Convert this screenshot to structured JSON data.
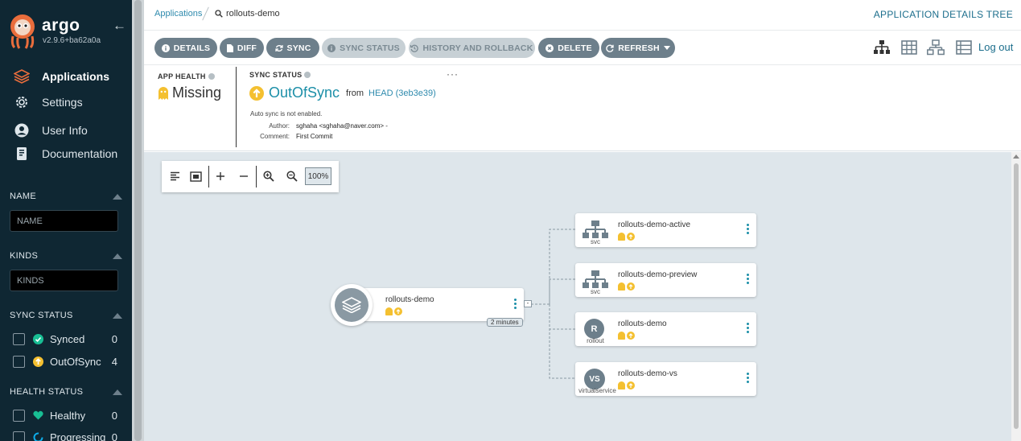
{
  "app": {
    "brand": "argo",
    "version": "v2.9.6+ba62a0a"
  },
  "nav": [
    {
      "label": "Applications",
      "icon": "layers-icon",
      "active": true
    },
    {
      "label": "Settings",
      "icon": "gear-icon"
    },
    {
      "label": "User Info",
      "icon": "user-icon"
    },
    {
      "label": "Documentation",
      "icon": "book-icon"
    }
  ],
  "filters": {
    "name": {
      "title": "NAME",
      "placeholder": "NAME"
    },
    "kinds": {
      "title": "KINDS",
      "placeholder": "KINDS"
    },
    "sync_status": {
      "title": "SYNC STATUS",
      "items": [
        {
          "label": "Synced",
          "count": "0",
          "color": "#18be94"
        },
        {
          "label": "OutOfSync",
          "count": "4",
          "color": "#f4c030"
        }
      ]
    },
    "health_status": {
      "title": "HEALTH STATUS",
      "items": [
        {
          "label": "Healthy",
          "count": "0",
          "color": "#18be94"
        },
        {
          "label": "Progressing",
          "count": "0",
          "color": "#0dadea"
        }
      ]
    }
  },
  "breadcrumb": {
    "root": "Applications",
    "current": "rollouts-demo"
  },
  "page_title": "APPLICATION DETAILS TREE",
  "toolbar": {
    "details": "DETAILS",
    "diff": "DIFF",
    "sync": "SYNC",
    "sync_status": "SYNC STATUS",
    "history": "HISTORY AND ROLLBACK",
    "delete": "DELETE",
    "refresh": "REFRESH",
    "logout": "Log out"
  },
  "status": {
    "health_label": "APP HEALTH",
    "health_value": "Missing",
    "sync_label": "SYNC STATUS",
    "sync_value": "OutOfSync",
    "from": "from",
    "revision": "HEAD (3eb3e39)",
    "auto_sync": "Auto sync is not enabled.",
    "author_key": "Author:",
    "author_value": "sghaha <sghaha@naver.com> -",
    "comment_key": "Comment:",
    "comment_value": "First Commit",
    "more": "···"
  },
  "graph": {
    "zoom": "100%",
    "root": {
      "name": "rollouts-demo",
      "age": "2 minutes"
    },
    "children": [
      {
        "name": "rollouts-demo-active",
        "kind": "svc",
        "icon": "network-icon"
      },
      {
        "name": "rollouts-demo-preview",
        "kind": "svc",
        "icon": "network-icon"
      },
      {
        "name": "rollouts-demo",
        "kind": "rollout",
        "icon_text": "R"
      },
      {
        "name": "rollouts-demo-vs",
        "kind": "virtualservice",
        "icon_text": "VS"
      }
    ]
  },
  "colors": {
    "sidebar": "#0f2733",
    "accent": "#1c8fa8",
    "button": "#6d7f8b",
    "warning": "#f4c030",
    "canvas": "#dee6eb"
  }
}
